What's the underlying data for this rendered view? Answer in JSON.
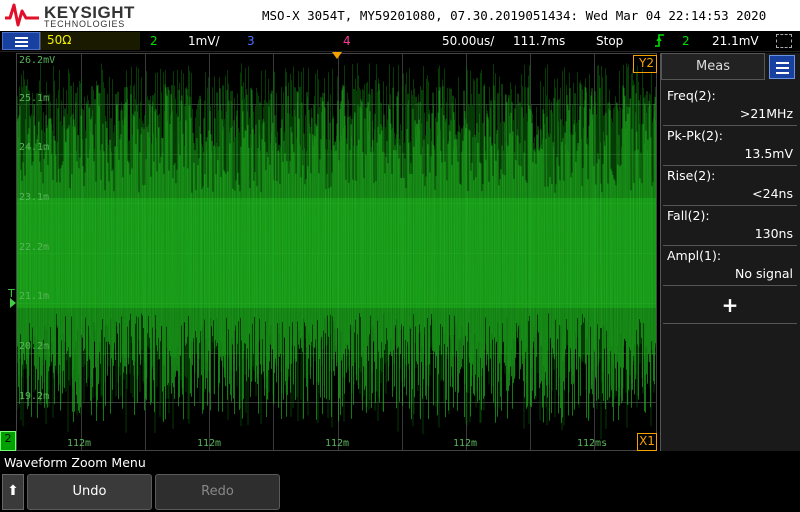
{
  "header": {
    "brand": "KEYSIGHT",
    "brand_sub": "TECHNOLOGIES",
    "device_info": "MSO-X 3054T, MY59201080, 07.30.2019051434: Wed Mar 04 22:14:53 2020"
  },
  "status": {
    "ch1_coupling": "50Ω",
    "ch2_label": "2",
    "ch2_scale": "1mV/",
    "ch3_label": "3",
    "ch4_label": "4",
    "timebase": "50.00us/",
    "delay": "111.7ms",
    "run_state": "Stop",
    "trigger_source": "2",
    "trigger_level": "21.1mV"
  },
  "graticule": {
    "y_labels": [
      "26.2mV",
      "25.1m",
      "24.1m",
      "23.1m",
      "22.2m",
      "21.1m",
      "20.2m",
      "19.2m"
    ],
    "x_labels": [
      "112m",
      "112m",
      "112m",
      "112m",
      "112ms"
    ],
    "trigger_level_marker": "T",
    "y2_cursor": "Y2",
    "x1_cursor": "X1",
    "ch2_ground": "2"
  },
  "meas_panel": {
    "title": "Meas",
    "items": [
      {
        "label": "Freq(2):",
        "value": ">21MHz"
      },
      {
        "label": "Pk-Pk(2):",
        "value": "13.5mV"
      },
      {
        "label": "Rise(2):",
        "value": "<24ns"
      },
      {
        "label": "Fall(2):",
        "value": "130ns"
      },
      {
        "label": "Ampl(1):",
        "value": "No signal"
      }
    ],
    "add_label": "+"
  },
  "bottom": {
    "menu_title": "Waveform Zoom Menu",
    "back_symbol": "⬆",
    "undo_label": "Undo",
    "redo_label": "Redo"
  },
  "colors": {
    "ch1": "#f0f000",
    "ch2": "#00ff00",
    "ch3": "#4a70ff",
    "ch4": "#ff3a9a",
    "trigger": "#f5a000",
    "menu_accent": "#1840a0"
  },
  "icons": {
    "menu": "hamburger-icon",
    "trigger": "trigger-slope-icon",
    "cursor": "cursor-box-icon",
    "back": "up-arrow-icon"
  }
}
